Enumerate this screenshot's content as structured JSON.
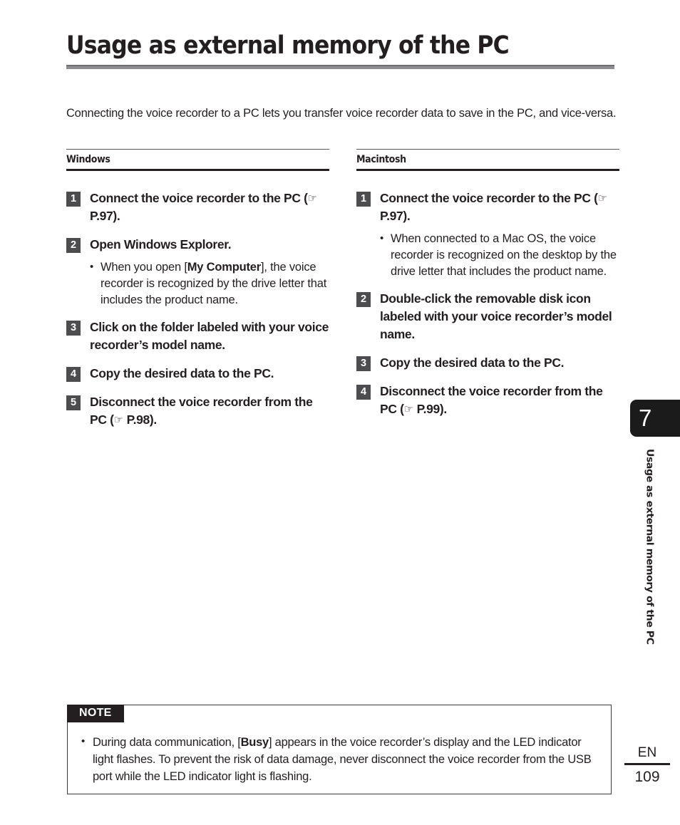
{
  "page": {
    "title": "Usage as external memory of the PC",
    "intro": "Connecting the voice recorder to a PC lets you transfer voice recorder data to save in the PC, and vice-versa."
  },
  "columns": [
    {
      "heading": "Windows",
      "steps": [
        {
          "num": "1",
          "text_before": "Connect the voice recorder to the PC (",
          "icon": "pointing-hand-icon",
          "icon_glyph": "☞",
          "text_after": " P.97).",
          "subnotes": []
        },
        {
          "num": "2",
          "text_before": "Open Windows Explorer.",
          "icon": "",
          "icon_glyph": "",
          "text_after": "",
          "subnotes": [
            {
              "pre": "When you open [",
              "bold": "My Computer",
              "post": "], the voice recorder is recognized by the drive letter that includes the product name."
            }
          ]
        },
        {
          "num": "3",
          "text_before": "Click on the folder labeled with your voice recorder’s model name.",
          "icon": "",
          "icon_glyph": "",
          "text_after": "",
          "subnotes": []
        },
        {
          "num": "4",
          "text_before": "Copy the desired data to the PC.",
          "icon": "",
          "icon_glyph": "",
          "text_after": "",
          "subnotes": []
        },
        {
          "num": "5",
          "text_before": "Disconnect the voice recorder from the PC (",
          "icon": "pointing-hand-icon",
          "icon_glyph": "☞",
          "text_after": " P.98).",
          "subnotes": []
        }
      ]
    },
    {
      "heading": "Macintosh",
      "steps": [
        {
          "num": "1",
          "text_before": "Connect the voice recorder to the PC (",
          "icon": "pointing-hand-icon",
          "icon_glyph": "☞",
          "text_after": " P.97).",
          "subnotes": [
            {
              "pre": "When connected to a Mac OS, the voice recorder is recognized on the desktop by the drive letter that includes the product name.",
              "bold": "",
              "post": ""
            }
          ]
        },
        {
          "num": "2",
          "text_before": "Double-click the removable disk icon labeled with your voice recorder’s model name.",
          "icon": "",
          "icon_glyph": "",
          "text_after": "",
          "subnotes": []
        },
        {
          "num": "3",
          "text_before": "Copy the desired data to the PC.",
          "icon": "",
          "icon_glyph": "",
          "text_after": "",
          "subnotes": []
        },
        {
          "num": "4",
          "text_before": "Disconnect the voice recorder from the PC (",
          "icon": "pointing-hand-icon",
          "icon_glyph": "☞",
          "text_after": " P.99).",
          "subnotes": []
        }
      ]
    }
  ],
  "chapter_tab": {
    "number": "7",
    "label": "Usage as external memory of the PC"
  },
  "note": {
    "badge": "NOTE",
    "items": [
      {
        "pre": "During data communication, [",
        "bold": "Busy",
        "post": "] appears in the voice recorder’s display and the LED indicator light flashes. To prevent the risk of data damage, never disconnect the voice recorder from the USB port while the LED indicator light is flashing."
      }
    ]
  },
  "footer": {
    "language": "EN",
    "page_number": "109"
  },
  "colors": {
    "text": "#231f20",
    "title_rule": "#8e8e92",
    "step_badge": "#4d4d4f",
    "note_badge": "#231f20",
    "tab": "#1b1b1b"
  }
}
